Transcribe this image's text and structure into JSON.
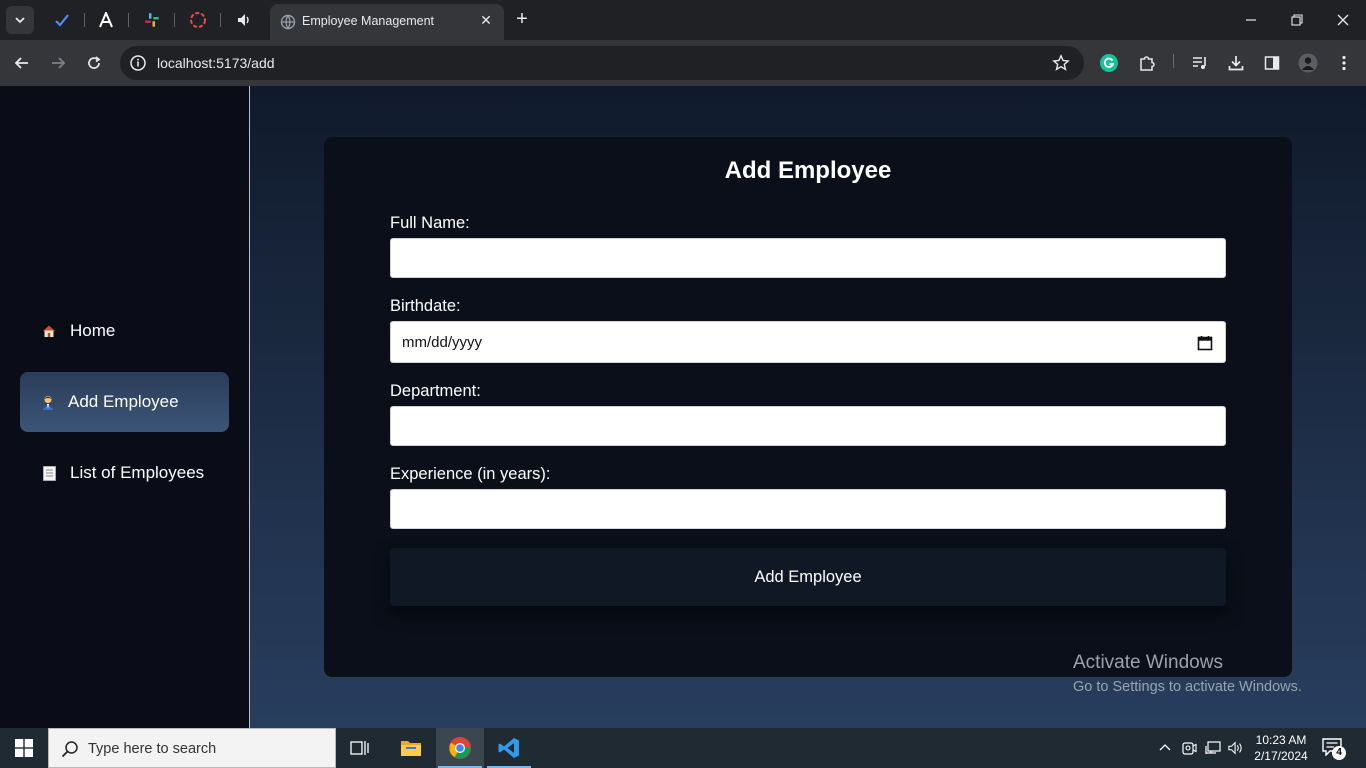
{
  "browser": {
    "active_tab_title": "Employee Management",
    "url": "localhost:5173/add"
  },
  "sidebar": {
    "items": [
      {
        "label": "Home",
        "icon": "house-icon"
      },
      {
        "label": "Add Employee",
        "icon": "office-worker-icon",
        "active": true
      },
      {
        "label": "List of Employees",
        "icon": "document-icon"
      }
    ]
  },
  "form": {
    "title": "Add Employee",
    "fields": [
      {
        "label": "Full Name:",
        "value": ""
      },
      {
        "label": "Birthdate:",
        "value": "mm/dd/yyyy"
      },
      {
        "label": "Department:",
        "value": ""
      },
      {
        "label": "Experience (in years):",
        "value": ""
      }
    ],
    "submit_label": "Add Employee"
  },
  "watermark": {
    "line1": "Activate Windows",
    "line2": "Go to Settings to activate Windows."
  },
  "taskbar": {
    "search_placeholder": "Type here to search",
    "time": "10:23 AM",
    "date": "2/17/2024",
    "notification_count": "4"
  },
  "colors": {
    "sidebar_bg": "#0a0d17",
    "sidebar_active": "#34496a",
    "card_bg": "#0a0f19",
    "main_bg_top": "#101a2b",
    "main_bg_bottom": "#283e5e"
  }
}
